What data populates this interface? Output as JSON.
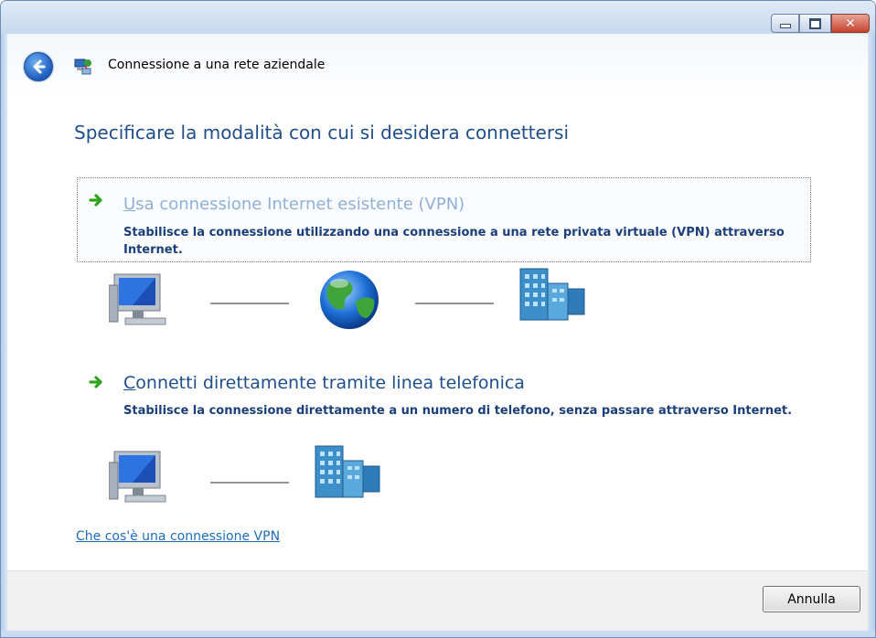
{
  "window": {
    "title": "Connessione a una rete aziendale",
    "buttons": {
      "minimize_icon": "minimize-icon",
      "maximize_icon": "maximize-icon",
      "close_icon": "close-icon"
    }
  },
  "nav": {
    "back_icon": "back-arrow-icon",
    "wizard_icon": "network-connection-icon"
  },
  "page": {
    "heading": "Specificare la modalità con cui si desidera connettersi"
  },
  "options": [
    {
      "title_accel": "U",
      "title_rest": "sa connessione Internet esistente (VPN)",
      "description": "Stabilisce la connessione utilizzando una connessione a una rete privata virtuale (VPN) attraverso Internet.",
      "selected": true,
      "diagram": [
        "computer-icon",
        "globe-icon",
        "office-building-icon"
      ]
    },
    {
      "title_accel": "C",
      "title_rest": "onnetti direttamente tramite linea telefonica",
      "description": "Stabilisce la connessione direttamente a un numero di telefono, senza passare attraverso Internet.",
      "selected": false,
      "diagram": [
        "computer-icon",
        "office-building-icon"
      ]
    }
  ],
  "help_link": "Che cos'è una connessione VPN",
  "footer": {
    "cancel_label": "Annulla"
  },
  "colors": {
    "heading": "#1e4e8c",
    "link": "#1e6bbf",
    "arrow": "#2fa51f"
  }
}
